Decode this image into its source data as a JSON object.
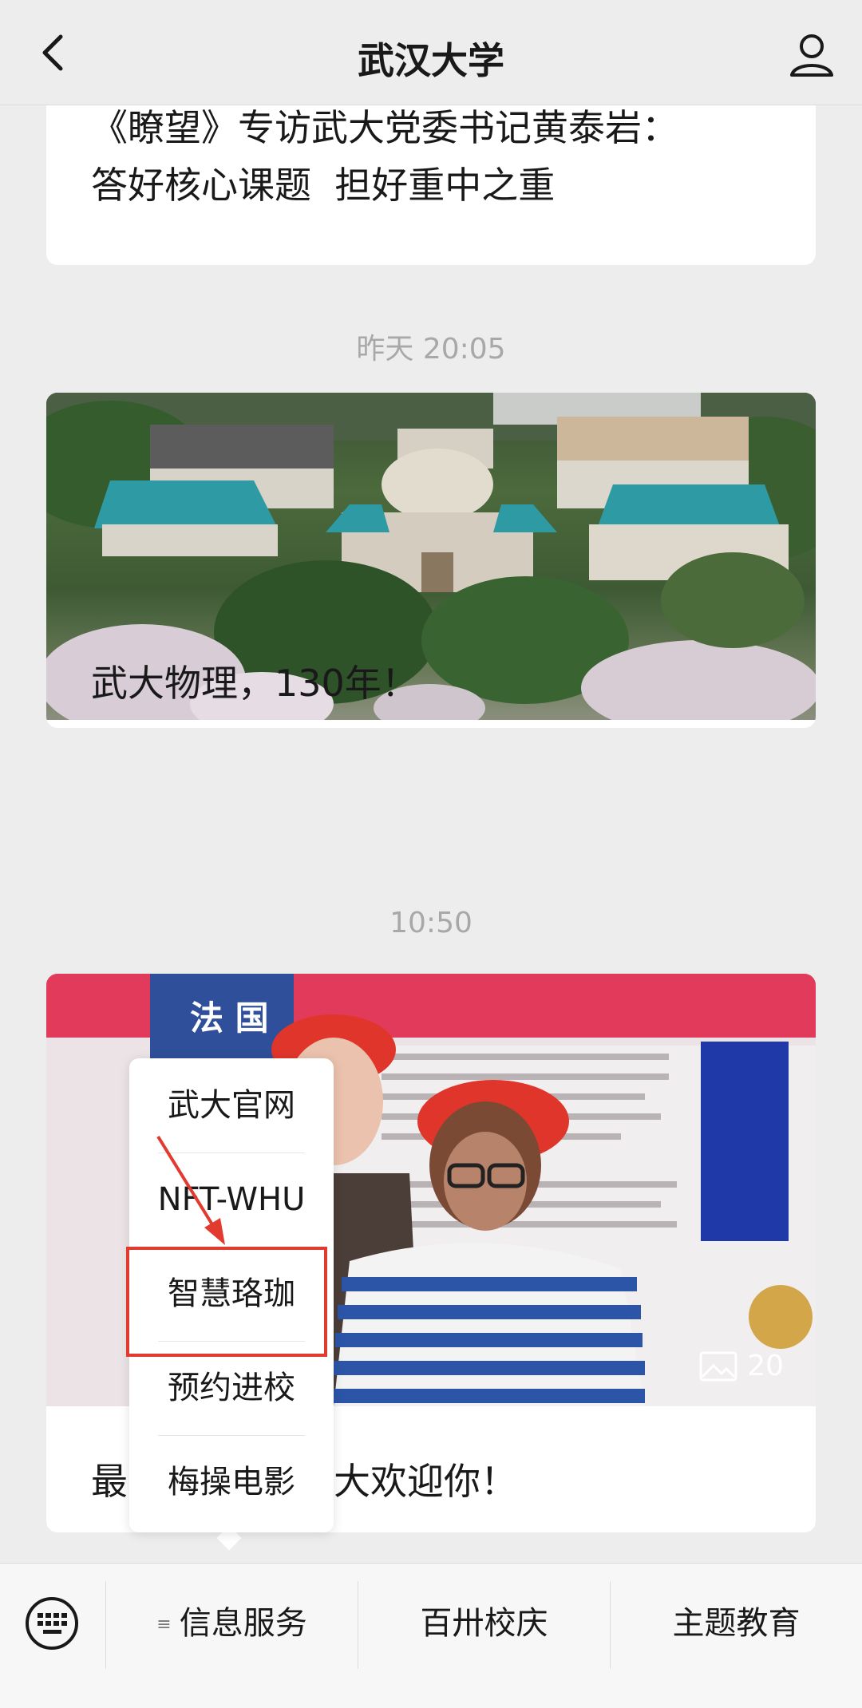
{
  "header": {
    "title": "武汉大学"
  },
  "feed": {
    "article_top": {
      "headline_line1": "《瞭望》专访武大党委书记黄泰岩：",
      "headline_line2": "答好核心课题  担好重中之重"
    },
    "time1": "昨天 20:05",
    "article1": {
      "title": "武大物理，130年！"
    },
    "time2": "10:50",
    "article2": {
      "title_start": "最",
      "title_end": "大欢迎你！",
      "photo_sign": "法 国",
      "photo_count": "20"
    }
  },
  "popup_menu": {
    "items": [
      "武大官网",
      "NFT-WHU",
      "智慧珞珈",
      "预约进校",
      "梅操电影"
    ]
  },
  "bottom_menu": {
    "items": [
      {
        "label": "信息服务",
        "has_submenu": true
      },
      {
        "label": "百卅校庆"
      },
      {
        "label": "主题教育"
      }
    ]
  },
  "colors": {
    "highlight": "#e33a2f",
    "background": "#ededed"
  }
}
